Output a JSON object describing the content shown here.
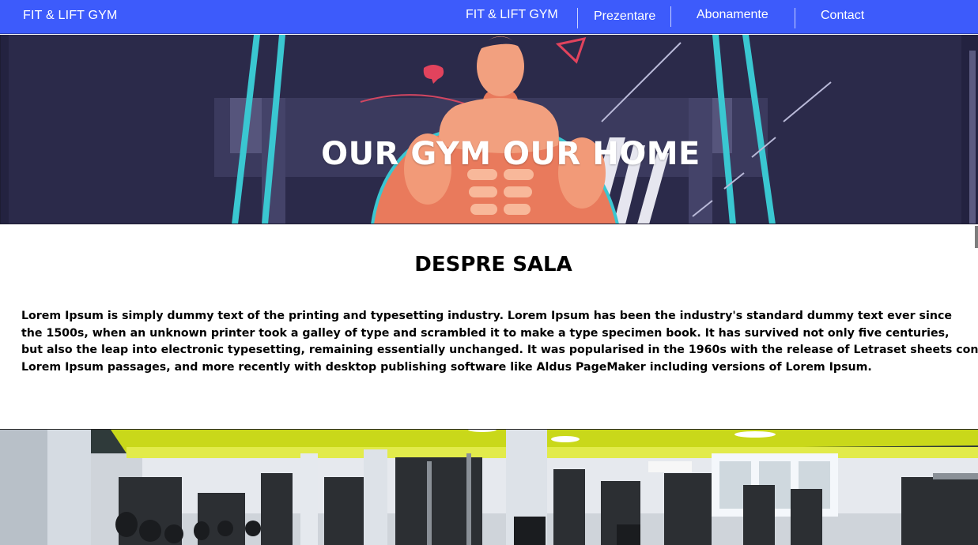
{
  "nav": {
    "brand": "FIT & LIFT GYM",
    "items": [
      {
        "label": "FIT & LIFT GYM"
      },
      {
        "label": "Prezentare"
      },
      {
        "label": "Abonamente"
      },
      {
        "label": "Contact"
      }
    ],
    "color": "#3d5bfb"
  },
  "hero": {
    "title": "OUR GYM OUR HOME"
  },
  "about": {
    "title": "DESPRE SALA",
    "lines": [
      "Lorem Ipsum is simply dummy text of the printing and typesetting industry. Lorem Ipsum has been the industry's standard dummy text ever since",
      "the 1500s, when an unknown printer took a galley of type and scrambled it to make a type specimen book. It has survived not only five centuries,",
      "but also the leap into electronic typesetting, remaining essentially unchanged. It was popularised in the 1960s with the release of Letraset sheets containing",
      "Lorem Ipsum passages, and more recently with desktop publishing software like Aldus PageMaker including versions of Lorem Ipsum."
    ]
  }
}
